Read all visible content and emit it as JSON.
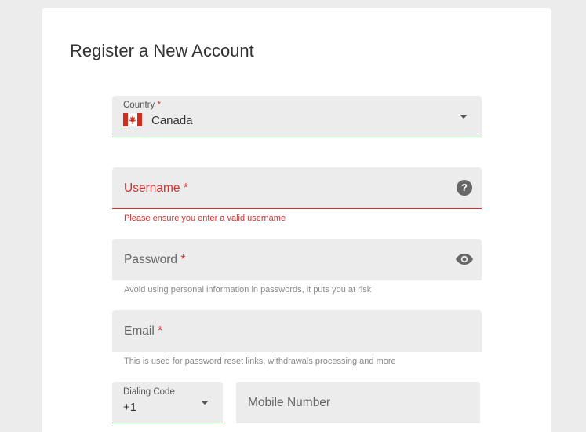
{
  "form": {
    "title": "Register a New Account",
    "country": {
      "label": "Country",
      "required_mark": "*",
      "value": "Canada",
      "flag_icon": "canada-flag-icon"
    },
    "username": {
      "label": "Username",
      "required_mark": "*",
      "error": "Please ensure you enter a valid username",
      "help_icon": "help-icon"
    },
    "password": {
      "label": "Password",
      "required_mark": "*",
      "helper": "Avoid using personal information in passwords, it puts you at risk",
      "toggle_icon": "eye-icon"
    },
    "email": {
      "label": "Email",
      "required_mark": "*",
      "helper": "This is used for password reset links, withdrawals processing and more"
    },
    "dialing_code": {
      "label": "Dialing Code",
      "value": "+1"
    },
    "mobile": {
      "placeholder": "Mobile Number"
    }
  },
  "colors": {
    "background": "#ececec",
    "card": "#ffffff",
    "field": "#ececec",
    "valid_border": "#4caf50",
    "error": "#d32f2f"
  }
}
